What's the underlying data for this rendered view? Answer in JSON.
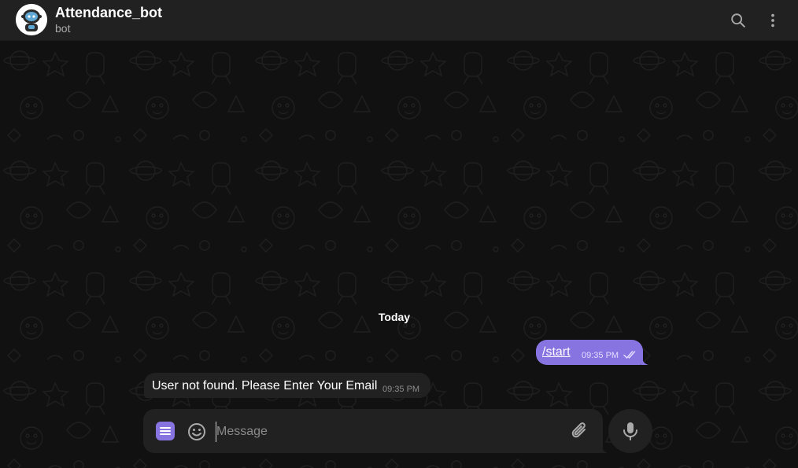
{
  "header": {
    "title": "Attendance_bot",
    "subtitle": "bot",
    "search_icon": "search-icon",
    "more_icon": "more-vertical-icon"
  },
  "chat": {
    "date_separator": "Today",
    "messages": [
      {
        "direction": "outgoing",
        "text": "/start",
        "time": "09:35 PM",
        "status": "read"
      },
      {
        "direction": "incoming",
        "text": "User not found. Please Enter Your Email",
        "time": "09:35 PM"
      }
    ]
  },
  "composer": {
    "placeholder": "Message",
    "value": ""
  },
  "colors": {
    "accent": "#8774e1",
    "background": "#0e0e0e",
    "surface": "#212121",
    "secondary_text": "#aaaaaa"
  }
}
